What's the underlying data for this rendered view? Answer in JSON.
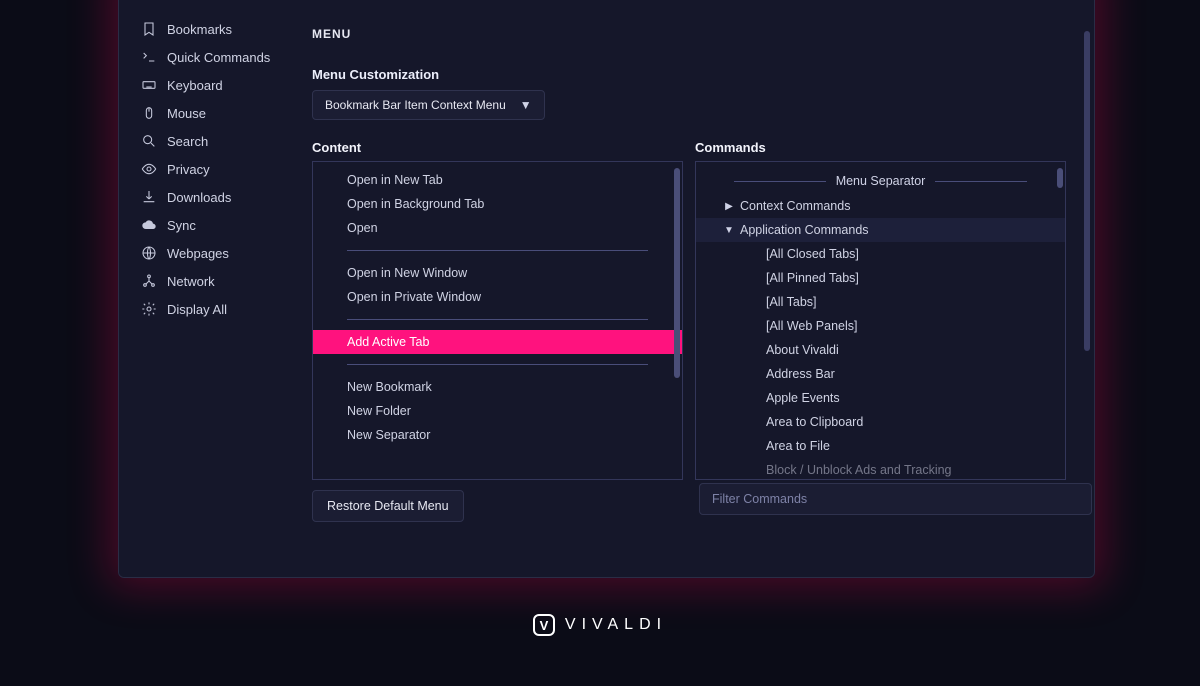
{
  "sidebar": {
    "items": [
      {
        "label": "Bookmarks",
        "icon": "bookmark-icon"
      },
      {
        "label": "Quick Commands",
        "icon": "quick-icon"
      },
      {
        "label": "Keyboard",
        "icon": "keyboard-icon"
      },
      {
        "label": "Mouse",
        "icon": "mouse-icon"
      },
      {
        "label": "Search",
        "icon": "search-icon"
      },
      {
        "label": "Privacy",
        "icon": "eye-icon"
      },
      {
        "label": "Downloads",
        "icon": "download-icon"
      },
      {
        "label": "Sync",
        "icon": "cloud-icon"
      },
      {
        "label": "Webpages",
        "icon": "globe-icon"
      },
      {
        "label": "Network",
        "icon": "network-icon"
      },
      {
        "label": "Display All",
        "icon": "gear-icon"
      }
    ]
  },
  "header": {
    "title": "MENU"
  },
  "customization": {
    "label": "Menu Customization",
    "dropdown_value": "Bookmark Bar Item Context Menu"
  },
  "content": {
    "title": "Content",
    "groups": [
      [
        "Open in New Tab",
        "Open in Background Tab",
        "Open"
      ],
      [
        "Open in New Window",
        "Open in Private Window"
      ],
      [
        "Add Active Tab"
      ],
      [
        "New Bookmark",
        "New Folder",
        "New Separator"
      ]
    ],
    "selected": "Add Active Tab",
    "restore_label": "Restore Default Menu"
  },
  "commands": {
    "title": "Commands",
    "menu_separator_label": "Menu Separator",
    "context_label": "Context Commands",
    "app_label": "Application Commands",
    "app_items": [
      "[All Closed Tabs]",
      "[All Pinned Tabs]",
      "[All Tabs]",
      "[All Web Panels]",
      "About Vivaldi",
      "Address Bar",
      "Apple Events",
      "Area to Clipboard",
      "Area to File",
      "Block / Unblock Ads and Tracking"
    ],
    "filter_placeholder": "Filter Commands"
  },
  "brand": "VIVALDI"
}
